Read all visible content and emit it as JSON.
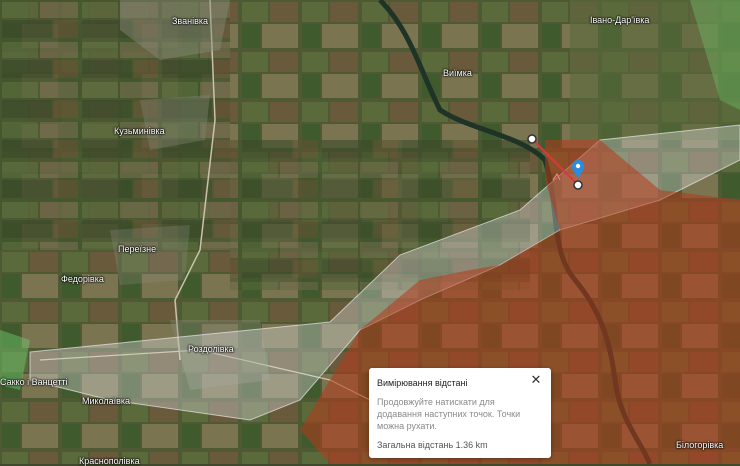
{
  "places": [
    {
      "id": "zvanivka",
      "name": "Званівка"
    },
    {
      "id": "ivano-darivka",
      "name": "Івано-Дар'ївка"
    },
    {
      "id": "viimka",
      "name": "Виїмка"
    },
    {
      "id": "kuzmynivka",
      "name": "Кузьминівка"
    },
    {
      "id": "pereizne",
      "name": "Переїзне"
    },
    {
      "id": "fedorivka",
      "name": "Федорівка"
    },
    {
      "id": "rozdolivka",
      "name": "Роздолівка"
    },
    {
      "id": "sakko",
      "name": "Сакко і Ванцетті"
    },
    {
      "id": "mykolaivka",
      "name": "Миколаївка"
    },
    {
      "id": "krasnopolivka",
      "name": "Краснополівка"
    },
    {
      "id": "bilohorivka",
      "name": "Білогорівка"
    }
  ],
  "colors": {
    "control_overlay": "#b53a1c",
    "gray_zone": "#d9d9d9",
    "contested": "#6fcf6f",
    "measure_line": "#d23b3b",
    "pin": "#2a8be0"
  },
  "icons": {
    "pin": "map-pin-icon",
    "start_point": "measure-start-icon",
    "end_point": "measure-end-icon",
    "close": "close-icon"
  },
  "measure_panel": {
    "title": "Вимірювання відстані",
    "hint": "Продовжуйте натискати для додавання наступних точок. Точки можна рухати.",
    "total": "Загальна відстань 1.36 km",
    "close_glyph": "✕"
  }
}
